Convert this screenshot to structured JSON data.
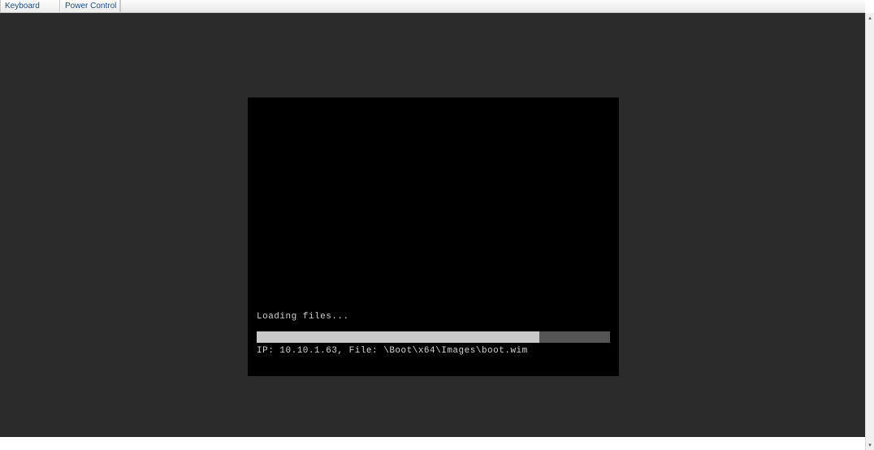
{
  "tabs": {
    "keyboard": "Keyboard",
    "power_control": "Power Control"
  },
  "console": {
    "loading_label": "Loading files...",
    "status_line": "IP: 10.10.1.63, File: \\Boot\\x64\\Images\\boot.wim",
    "progress_percent": 80
  },
  "icons": {
    "scroll_up": "▴",
    "scroll_down": "▾"
  }
}
